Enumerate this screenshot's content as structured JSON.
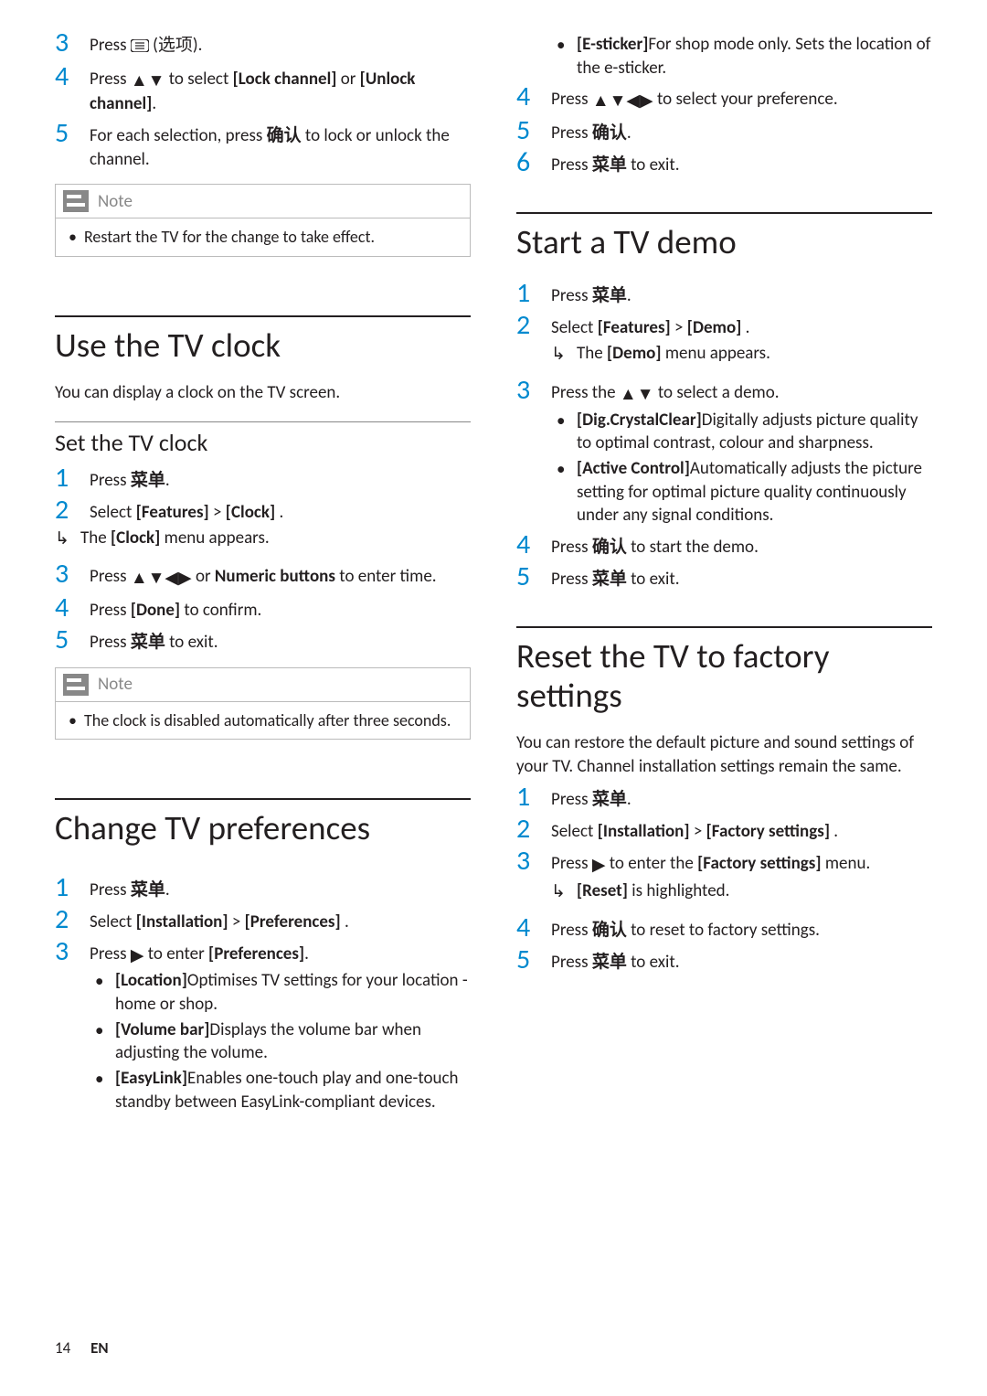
{
  "icons": {
    "options_btn": "▤",
    "up_down": "▲▼",
    "all_arrows": "▲▼◀▶",
    "right": "▶",
    "result_arrow": "↳"
  },
  "labels": {
    "options_cn": "选项",
    "confirm_cn": "确认",
    "menu_cn": "菜单",
    "note": "Note"
  },
  "left": {
    "lock": {
      "s3": {
        "num": "3",
        "a": "Press ",
        "cn": "options_cn",
        "b": "."
      },
      "s4": {
        "num": "4",
        "a": "Press ",
        "b": " to select ",
        "bold1": "[Lock channel]",
        "c": " or ",
        "bold2": "[Unlock channel]",
        "d": "."
      },
      "s5": {
        "num": "5",
        "a": "For each selection, press ",
        "b": " to lock or unlock the channel."
      },
      "note": "Restart the TV for the change to take effect."
    },
    "clock": {
      "title": "Use the TV clock",
      "intro": "You can display a clock on the TV screen.",
      "sub": "Set the TV clock",
      "s1": {
        "num": "1",
        "a": "Press ",
        "b": "."
      },
      "s2": {
        "num": "2",
        "a": " Select ",
        "bold1": "[Features]",
        "b": " > ",
        "bold2": "[Clock]",
        "c": " ."
      },
      "r2": {
        "a": "The ",
        "bold": "[Clock]",
        "b": " menu appears."
      },
      "s3": {
        "num": "3",
        "a": "Press ",
        "b": " or ",
        "bold1": "Numeric buttons",
        "c": " to enter time."
      },
      "s4": {
        "num": "4",
        "a": "Press ",
        "bold1": "[Done]",
        "b": " to confirm."
      },
      "s5": {
        "num": "5",
        "a": "Press ",
        "b": " to exit."
      },
      "note": "The clock is disabled automatically after three seconds."
    },
    "prefs": {
      "title": "Change TV preferences",
      "s1": {
        "num": "1",
        "a": "Press ",
        "b": "."
      },
      "s2": {
        "num": "2",
        "a": "Select ",
        "bold1": "[Installation]",
        "b": " > ",
        "bold2": " [Preferences]",
        "c": " ."
      },
      "s3": {
        "num": "3",
        "a": "Press ",
        "b": " to enter ",
        "bold1": "[Preferences]",
        "c": "."
      },
      "b1": {
        "bold": "[Location]",
        "text": "Optimises TV settings for your location - home or shop."
      },
      "b2": {
        "bold": "[Volume bar]",
        "text": "Displays the volume bar when adjusting the volume."
      },
      "b3": {
        "bold": "[EasyLink]",
        "text": "Enables one-touch play and one-touch standby between EasyLink-compliant devices."
      }
    }
  },
  "right": {
    "prefs_cont": {
      "b4": {
        "bold": "[E-sticker]",
        "text": "For shop mode only. Sets the location of the e-sticker."
      },
      "s4": {
        "num": "4",
        "a": "Press ",
        "b": " to select your preference."
      },
      "s5": {
        "num": "5",
        "a": "Press ",
        "b": "."
      },
      "s6": {
        "num": "6",
        "a": "Press ",
        "b": " to exit."
      }
    },
    "demo": {
      "title": "Start a TV demo",
      "s1": {
        "num": "1",
        "a": "Press ",
        "b": "."
      },
      "s2": {
        "num": "2",
        "a": "Select ",
        "bold1": "[Features]",
        "b": " > ",
        "bold2": "[Demo]",
        "c": " ."
      },
      "r2": {
        "a": "The ",
        "bold": "[Demo]",
        "b": " menu appears."
      },
      "s3": {
        "num": "3",
        "a": "Press the ",
        "b": " to select a demo."
      },
      "b1": {
        "bold": "[Dig.CrystalClear]",
        "text": "Digitally adjusts picture quality to optimal contrast, colour and sharpness."
      },
      "b2": {
        "bold": "[Active Control]",
        "text": "Automatically adjusts the picture setting for optimal picture quality continuously under any signal conditions."
      },
      "s4": {
        "num": "4",
        "a": "Press ",
        "b": " to start the demo."
      },
      "s5": {
        "num": "5",
        "a": "Press ",
        "b": " to exit."
      }
    },
    "reset": {
      "title": "Reset the TV to factory settings",
      "intro": "You can restore the default picture and sound settings of your TV. Channel installation settings remain the same.",
      "s1": {
        "num": "1",
        "a": "Press ",
        "b": "."
      },
      "s2": {
        "num": "2",
        "a": "Select ",
        "bold1": "[Installation]",
        "b": " > ",
        "bold2": "[Factory settings]",
        "c": " ."
      },
      "s3": {
        "num": "3",
        "a": "Press ",
        "b": " to enter the ",
        "bold1": "[Factory settings]",
        "c": " menu."
      },
      "r3": {
        "bold": "[Reset]",
        "b": " is highlighted."
      },
      "s4": {
        "num": "4",
        "a": "Press ",
        "b": " to reset to factory settings."
      },
      "s5": {
        "num": "5",
        "a": "Press ",
        "b": " to exit."
      }
    }
  },
  "footer": {
    "page": "14",
    "lang": "EN"
  }
}
